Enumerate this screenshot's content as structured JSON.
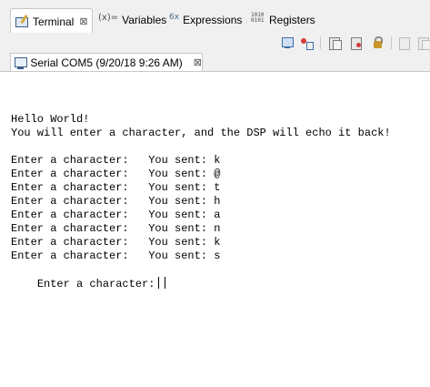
{
  "view_tabs": [
    {
      "label": "Terminal",
      "icon": "terminal-icon",
      "active": true,
      "close": "⊠"
    },
    {
      "label": "Variables",
      "icon": "variables-icon",
      "icon_text": "(x)="
    },
    {
      "label": "Expressions",
      "icon": "expressions-icon",
      "icon_text": "6x"
    },
    {
      "label": "Registers",
      "icon": "registers-icon",
      "icon_text": "1010\n0101"
    }
  ],
  "toolbar": {
    "buttons": [
      "new-terminal-icon",
      "disconnect-icon",
      "copy-icon",
      "clear-icon",
      "lock-icon",
      "paste-icon",
      "select-all-icon"
    ]
  },
  "console_tab": {
    "label": "Serial COM5 (9/20/18 9:26 AM)",
    "close": "⊠"
  },
  "terminal": {
    "lines": [
      "Hello World!",
      "You will enter a character, and the DSP will echo it back!",
      "",
      "Enter a character:   You sent: k",
      "Enter a character:   You sent: @",
      "Enter a character:   You sent: t",
      "Enter a character:   You sent: h",
      "Enter a character:   You sent: a",
      "Enter a character:   You sent: n",
      "Enter a character:   You sent: k",
      "Enter a character:   You sent: s"
    ],
    "prompt": "Enter a character:"
  }
}
